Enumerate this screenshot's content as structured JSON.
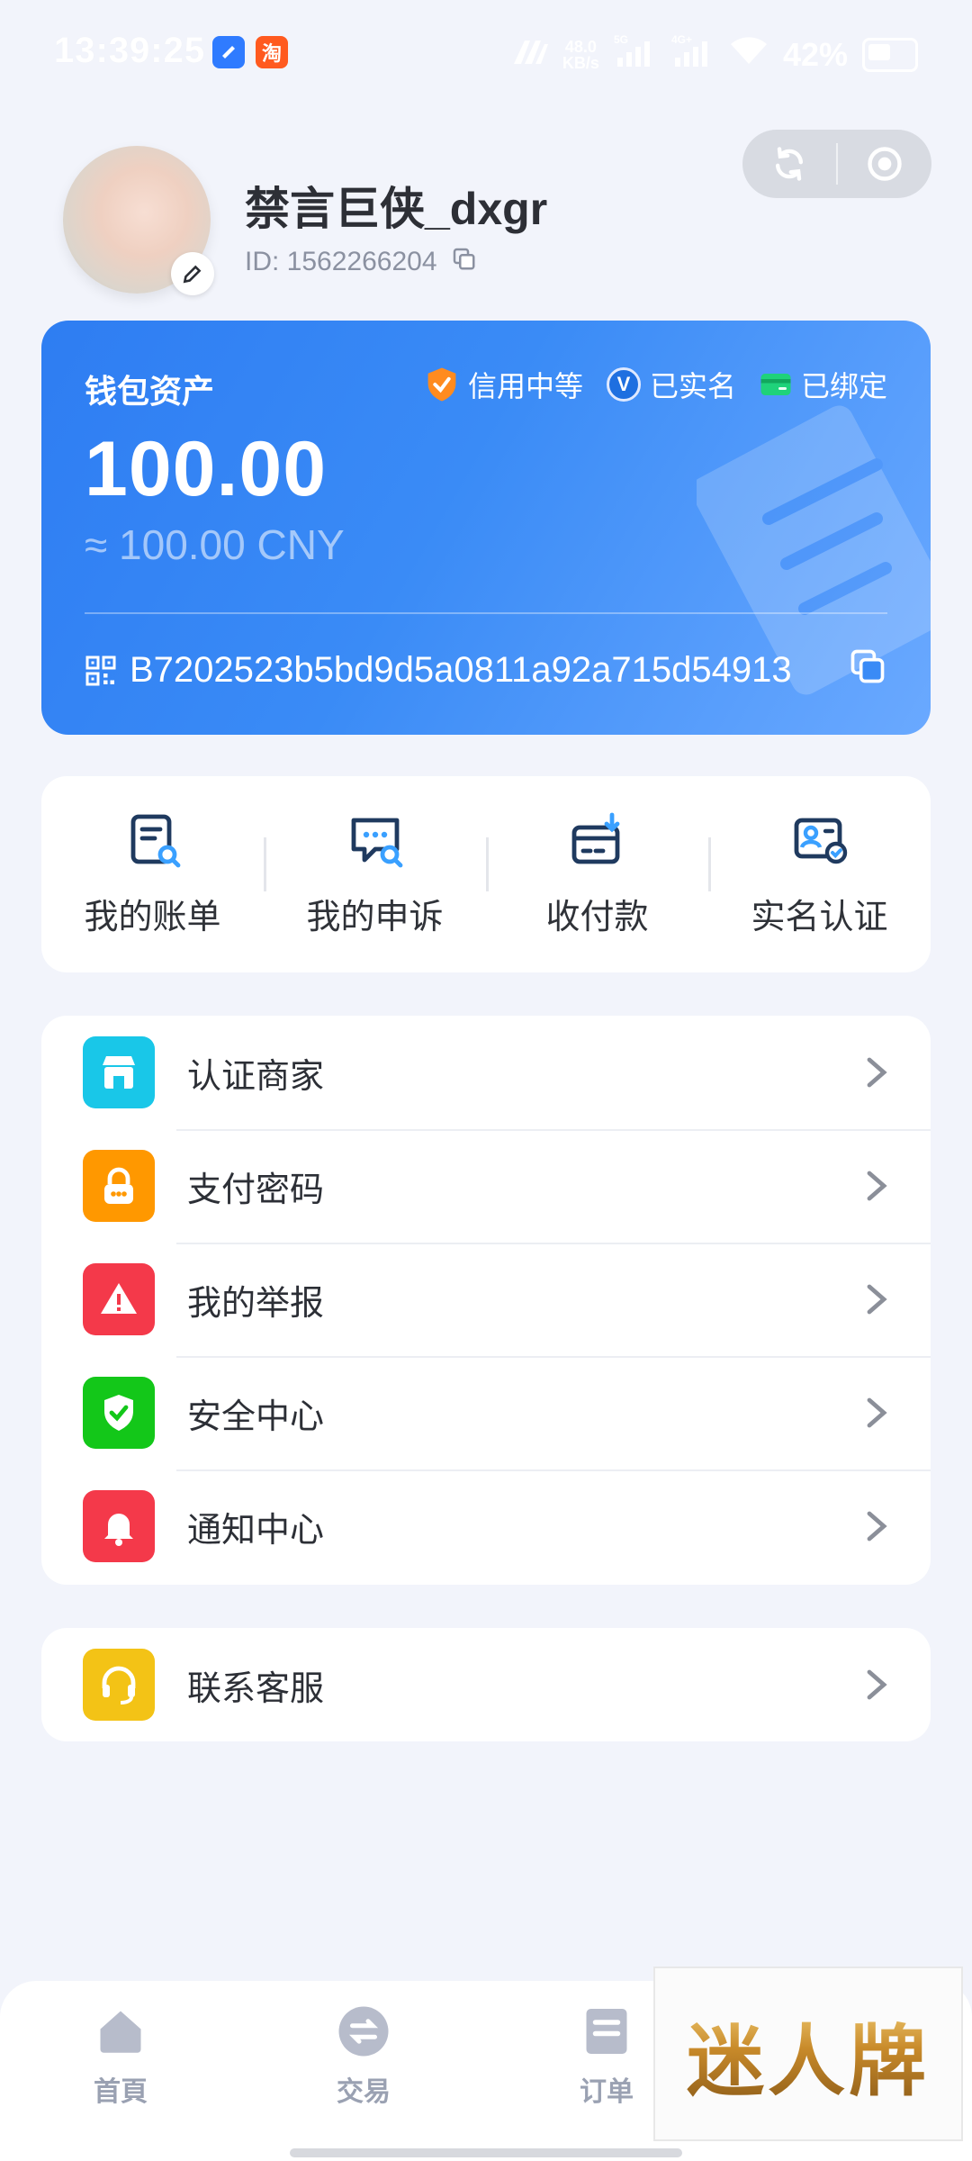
{
  "status_bar": {
    "time": "13:39:25",
    "apps": [
      "blue-app-icon",
      "taobao-icon"
    ],
    "app2_label": "淘",
    "net_speed": "48.0",
    "net_unit": "KB/s",
    "net_type_1": "5G",
    "net_type_2": "4G+",
    "battery": "42%"
  },
  "profile": {
    "username": "禁言巨侠_dxgr",
    "id_text": "ID: 1562266204"
  },
  "wallet": {
    "title": "钱包资产",
    "badges": {
      "credit": "信用中等",
      "verified": "已实名",
      "verified_mark": "V",
      "bound": "已绑定"
    },
    "amount": "100.00",
    "cny": "≈ 100.00 CNY",
    "address": "B7202523b5bd9d5a0811a92a715d54913",
    "colors": {
      "gradient_start": "#2e7df2",
      "gradient_end": "#6aa9ff"
    }
  },
  "quick_actions": [
    {
      "label": "我的账单",
      "icon": "bill-search-icon"
    },
    {
      "label": "我的申诉",
      "icon": "appeal-chat-icon"
    },
    {
      "label": "收付款",
      "icon": "card-receive-icon"
    },
    {
      "label": "实名认证",
      "icon": "id-card-verify-icon"
    }
  ],
  "menu": [
    {
      "label": "认证商家",
      "icon": "store-icon",
      "color": "#19c7e8"
    },
    {
      "label": "支付密码",
      "icon": "lock-icon",
      "color": "#ff9800"
    },
    {
      "label": "我的举报",
      "icon": "warning-icon",
      "color": "#f4394a"
    },
    {
      "label": "安全中心",
      "icon": "shield-check-icon",
      "color": "#13c719"
    },
    {
      "label": "通知中心",
      "icon": "bell-icon",
      "color": "#f4394a"
    }
  ],
  "menu2": [
    {
      "label": "联系客服",
      "icon": "headset-icon",
      "color": "#f3c316"
    }
  ],
  "bottom_nav": {
    "home": "首頁",
    "trade": "交易",
    "orders": "订单"
  },
  "watermark": "迷人牌"
}
